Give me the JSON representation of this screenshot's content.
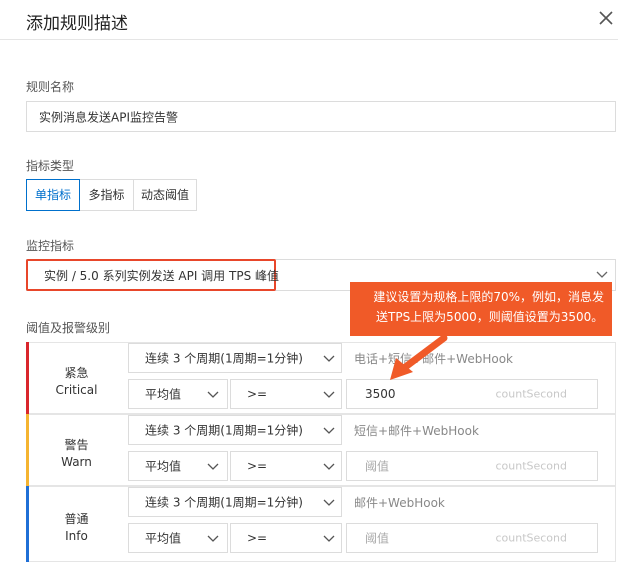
{
  "dialog": {
    "title": "添加规则描述",
    "close_icon": "close-icon"
  },
  "rule_name": {
    "label": "规则名称",
    "value": "实例消息发送API监控告警"
  },
  "metric_type": {
    "label": "指标类型",
    "options": [
      "单指标",
      "多指标",
      "动态阈值"
    ],
    "selected": "单指标"
  },
  "metric": {
    "label": "监控指标",
    "value": "实例 / 5.0 系列实例发送 API 调用 TPS 峰值"
  },
  "threshold_section": {
    "label": "阈值及报警级别"
  },
  "callout": {
    "line1": "建议设置为规格上限的70%，例如，消息发",
    "line2": "送TPS上限为5000，则阈值设置为3500。",
    "color": "#f05a28"
  },
  "tiers": [
    {
      "name_zh": "紧急",
      "name_en": "Critical",
      "color": "#d9262c",
      "period": "连续 3 个周期(1周期=1分钟)",
      "notify": "电话+短信+邮件+WebHook",
      "stat": "平均值",
      "operator": ">=",
      "threshold_value": "3500",
      "threshold_placeholder": "阈值",
      "unit": "countSecond"
    },
    {
      "name_zh": "警告",
      "name_en": "Warn",
      "color": "#f5b431",
      "period": "连续 3 个周期(1周期=1分钟)",
      "notify": "短信+邮件+WebHook",
      "stat": "平均值",
      "operator": ">=",
      "threshold_value": "",
      "threshold_placeholder": "阈值",
      "unit": "countSecond"
    },
    {
      "name_zh": "普通",
      "name_en": "Info",
      "color": "#1f6fd6",
      "period": "连续 3 个周期(1周期=1分钟)",
      "notify": "邮件+WebHook",
      "stat": "平均值",
      "operator": ">=",
      "threshold_value": "",
      "threshold_placeholder": "阈值",
      "unit": "countSecond"
    }
  ]
}
